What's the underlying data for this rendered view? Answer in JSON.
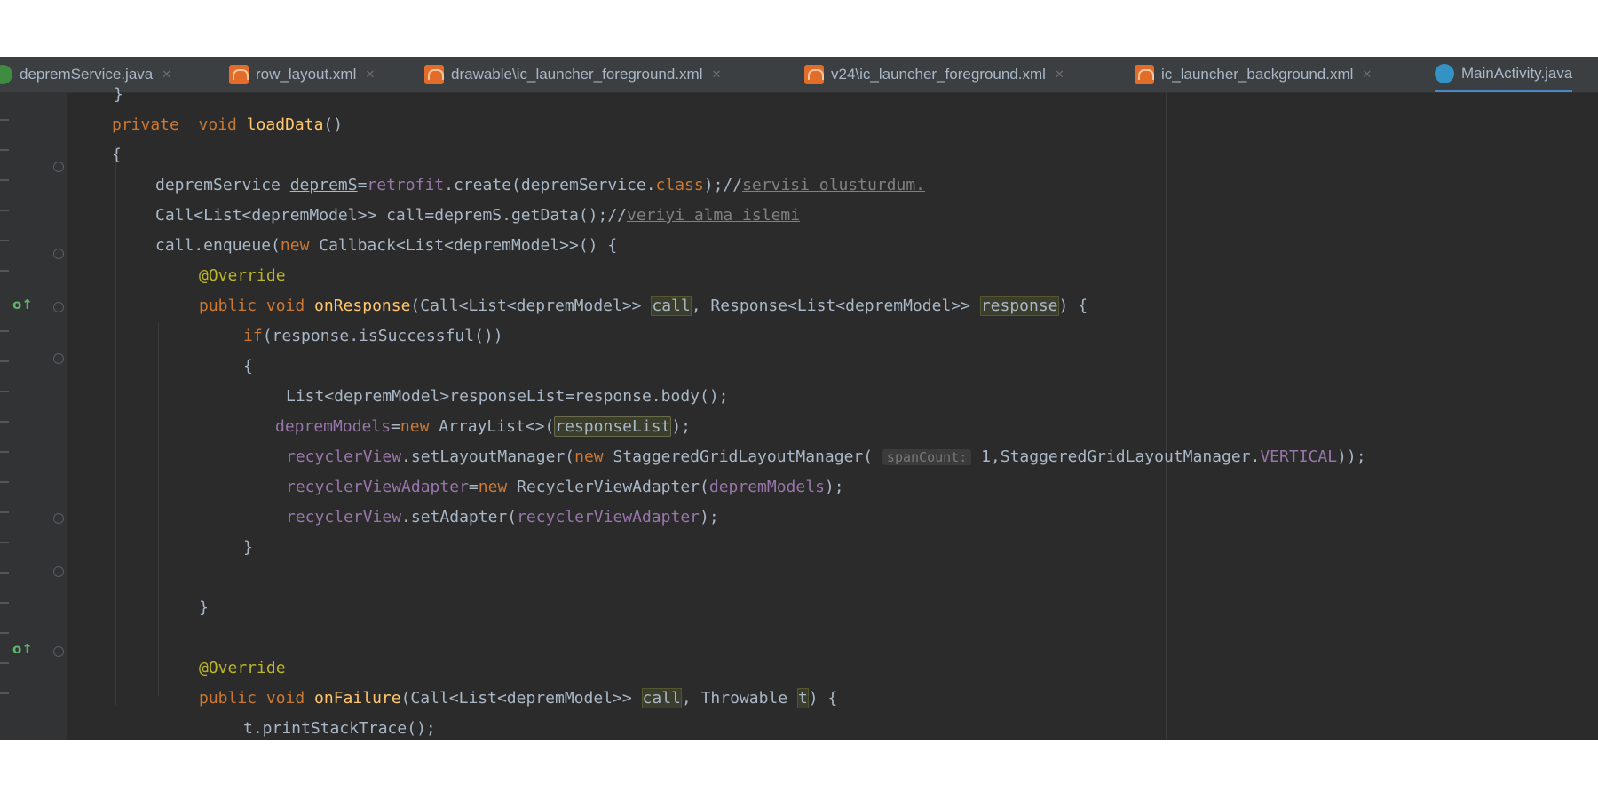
{
  "tabs": [
    {
      "label": "depremService.java",
      "icon": "java-file-icon"
    },
    {
      "label": "row_layout.xml",
      "icon": "xml-file-icon"
    },
    {
      "label": "drawable\\ic_launcher_foreground.xml",
      "icon": "xml-file-icon"
    },
    {
      "label": "v24\\ic_launcher_foreground.xml",
      "icon": "xml-file-icon"
    },
    {
      "label": "ic_launcher_background.xml",
      "icon": "xml-file-icon"
    },
    {
      "label": "MainActivity.java",
      "icon": "class-file-icon"
    }
  ],
  "code": {
    "l0": "}",
    "l1_kw": "private  void ",
    "l1_fn": "loadData",
    "l1_rest": "()",
    "l2": "{",
    "l3_a": "depremService ",
    "l3_b": "depremS",
    "l3_c": "=",
    "l3_d": "retrofit",
    "l3_e": ".create(depremService.",
    "l3_f": "class",
    "l3_g": ");//",
    "l3_h": "servisi olusturdum.",
    "l4_a": "Call<List<depremModel>> call=depremS.getData();//",
    "l4_b": "veriyi alma islemi",
    "l5_a": "call.enqueue(",
    "l5_b": "new ",
    "l5_c": "Callback<List<depremModel>>() {",
    "l6": "@Override",
    "l7_a": "public void ",
    "l7_b": "onResponse",
    "l7_c": "(Call<List<depremModel>> ",
    "l7_d": "call",
    "l7_e": ", Response<List<depremModel>> ",
    "l7_f": "response",
    "l7_g": ") {",
    "l8_a": "if",
    "l8_b": "(response.isSuccessful())",
    "l9": "{",
    "l10": "List<depremModel>responseList=response.body();",
    "l11_a": "depremModels",
    "l11_b": "=",
    "l11_c": "new ",
    "l11_d": "ArrayList<>(",
    "l11_e": "responseList",
    "l11_f": ");",
    "l12_a": "recyclerView",
    "l12_b": ".setLayoutManager(",
    "l12_c": "new ",
    "l12_d": "StaggeredGridLayoutManager( ",
    "l12_hint": "spanCount:",
    "l12_e": " 1,StaggeredGridLayoutManager.",
    "l12_f": "VERTICAL",
    "l12_g": "));",
    "l13_a": "recyclerViewAdapter",
    "l13_b": "=",
    "l13_c": "new ",
    "l13_d": "RecyclerViewAdapter(",
    "l13_e": "depremModels",
    "l13_f": ");",
    "l14_a": "recyclerView",
    "l14_b": ".setAdapter(",
    "l14_c": "recyclerViewAdapter",
    "l14_d": ");",
    "l15": "}",
    "l17": "}",
    "l19": "@Override",
    "l20_a": "public void ",
    "l20_b": "onFailure",
    "l20_c": "(Call<List<depremModel>> ",
    "l20_d": "call",
    "l20_e": ", Throwable ",
    "l20_f": "t",
    "l20_g": ") {",
    "l21": "t.printStackTrace();"
  },
  "colors": {
    "editor_bg": "#2b2b2b",
    "keyword": "#cc7832",
    "method": "#ffc66d",
    "field": "#9876aa",
    "annotation": "#bbb529",
    "comment": "#808080",
    "text": "#a9b7c6"
  }
}
